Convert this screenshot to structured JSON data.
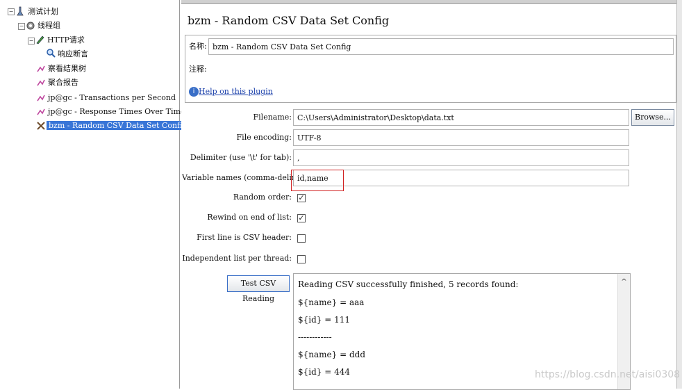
{
  "tree": {
    "test_plan": "测试计划",
    "thread_group": "线程组",
    "http_request": "HTTP请求",
    "response_assertion": "响应断言",
    "view_results_tree": "察看结果树",
    "aggregate_report": "聚合报告",
    "tps": "jp@gc - Transactions per Second",
    "response_times": "jp@gc - Response Times Over Time",
    "csv_config": "bzm - Random CSV Data Set Config"
  },
  "panel": {
    "title": "bzm - Random CSV Data Set Config",
    "name_label": "名称:",
    "name_value": "bzm - Random CSV Data Set Config",
    "comment_label": "注释:",
    "help_link": "Help on this plugin",
    "filename_label": "Filename:",
    "filename_value": "C:\\Users\\Administrator\\Desktop\\data.txt",
    "browse_label": "Browse...",
    "encoding_label": "File encoding:",
    "encoding_value": "UTF-8",
    "delimiter_label": "Delimiter (use '\\t' for tab):",
    "delimiter_value": ",",
    "varnames_label": "Variable names (comma-delimited):",
    "varnames_value": "id,name",
    "random_order_label": "Random order:",
    "random_order_checked": true,
    "rewind_label": "Rewind on end of list:",
    "rewind_checked": true,
    "first_line_label": "First line is CSV header:",
    "first_line_checked": false,
    "independent_label": "Independent list per thread:",
    "independent_checked": false,
    "test_button": "Test CSV Reading",
    "output_lines": [
      "Reading CSV successfully finished, 5 records found:",
      "${name} = aaa",
      "${id} = 111",
      "------------",
      "${name} = ddd",
      "${id} = 444"
    ]
  },
  "watermark": "https://blog.csdn.net/aisi0308",
  "colors": {
    "selection": "#3875d7",
    "highlight_box": "#d02020",
    "link": "#1a3faa"
  }
}
